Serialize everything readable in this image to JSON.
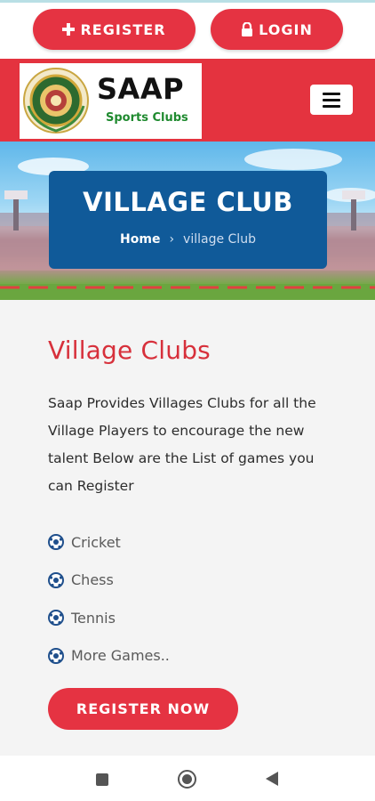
{
  "top_buttons": {
    "register": {
      "label": "REGISTER",
      "icon": "plus-icon"
    },
    "login": {
      "label": "LOGIN",
      "icon": "lock-icon"
    }
  },
  "brand": {
    "name": "SAAP",
    "tagline": "Sports Clubs",
    "colors": {
      "primary_red": "#e53342",
      "brand_green": "#1f8a2f",
      "hero_blue": "#105a99"
    }
  },
  "menu": {
    "icon": "hamburger-menu-icon"
  },
  "hero": {
    "title": "VILLAGE CLUB",
    "breadcrumb": {
      "home": "Home",
      "separator": "›",
      "current": "village Club"
    }
  },
  "content": {
    "heading": "Village Clubs",
    "description": "Saap Provides Villages Clubs for all the Village Players to encourage the new talent Below are the List of games you can Register",
    "games": [
      "Cricket",
      "Chess",
      "Tennis",
      "More Games.."
    ],
    "game_icon": "soccer-ball-icon",
    "cta_label": "REGISTER NOW"
  },
  "system_nav": {
    "icons": [
      "recents-square-icon",
      "home-circle-icon",
      "back-triangle-icon"
    ]
  }
}
